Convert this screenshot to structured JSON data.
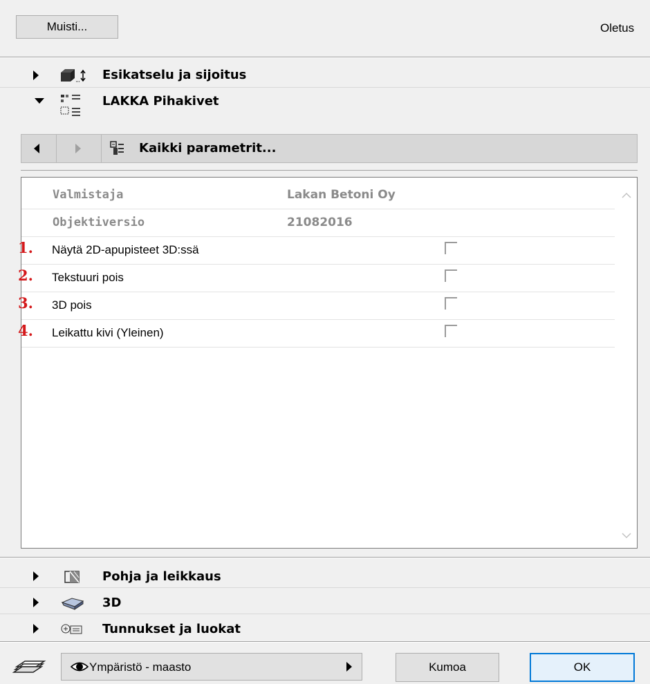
{
  "top": {
    "memory_button": "Muisti...",
    "default_label": "Oletus"
  },
  "sections_top": [
    {
      "label": "Esikatselu ja sijoitus",
      "expanded": false,
      "icon": "box-placement-icon"
    },
    {
      "label": "LAKKA Pihakivet",
      "expanded": true,
      "icon": "object-params-icon"
    }
  ],
  "param_nav": {
    "title": "Kaikki parametrit...",
    "back_icon": "triangle-left-icon",
    "forward_icon": "triangle-right-icon"
  },
  "params": {
    "rows": [
      {
        "num": "",
        "name": "Valmistaja",
        "value": "Lakan Betoni Oy",
        "type": "info"
      },
      {
        "num": "",
        "name": "Objektiversio",
        "value": "21082016",
        "type": "info"
      },
      {
        "num": "1.",
        "name": "Näytä 2D-apupisteet 3D:ssä",
        "checked": false,
        "type": "check"
      },
      {
        "num": "2.",
        "name": "Tekstuuri pois",
        "checked": false,
        "type": "check"
      },
      {
        "num": "3.",
        "name": "3D pois",
        "checked": false,
        "type": "check"
      },
      {
        "num": "4.",
        "name": "Leikattu kivi (Yleinen)",
        "checked": false,
        "type": "check"
      }
    ]
  },
  "sections_bottom": [
    {
      "label": "Pohja ja leikkaus",
      "expanded": false,
      "icon": "floor-plan-section-icon"
    },
    {
      "label": "3D",
      "expanded": false,
      "icon": "3d-shape-icon"
    },
    {
      "label": "Tunnukset ja luokat",
      "expanded": false,
      "icon": "id-categories-icon"
    }
  ],
  "footer": {
    "layer_icon": "layers-icon",
    "layer_value": "Ympäristö - maasto",
    "cancel_label": "Kumoa",
    "ok_label": "OK"
  },
  "colors": {
    "number_red": "#d4191b",
    "panel_bg": "#f0f0f0",
    "param_bg": "#ffffff"
  }
}
